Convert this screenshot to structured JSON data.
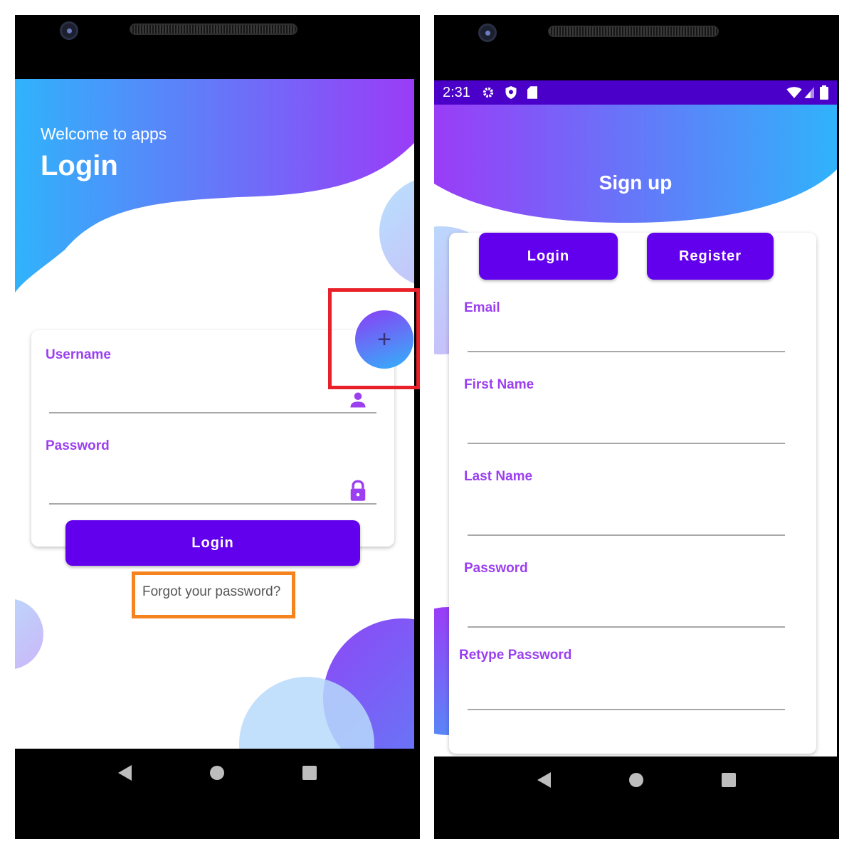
{
  "colors": {
    "accent": "#6200ee",
    "label": "#9b3ff0",
    "gradient_blue": "#30b3fb",
    "gradient_purple": "#9a3cf7",
    "status_bar": "#4a00c8",
    "highlight_red": "#e8202a",
    "highlight_orange": "#f5841f"
  },
  "login_screen": {
    "greeting": "Welcome to apps",
    "title": "Login",
    "fab_label": "+",
    "username_label": "Username",
    "username_icon": "person-icon",
    "password_label": "Password",
    "password_icon": "lock-icon",
    "login_button": "Login",
    "forgot_link": "Forgot your password?"
  },
  "signup_screen": {
    "status": {
      "time": "2:31",
      "icons": [
        "gear-icon",
        "shield-icon",
        "sd-card-icon",
        "wifi-icon",
        "signal-icon",
        "battery-icon"
      ]
    },
    "title": "Sign up",
    "tabs": [
      "Login",
      "Register"
    ],
    "fields": [
      "Email",
      "First Name",
      "Last Name",
      "Password",
      "Retype Password"
    ]
  },
  "navigation": {
    "icons": [
      "back-icon",
      "home-icon",
      "recents-icon"
    ]
  }
}
